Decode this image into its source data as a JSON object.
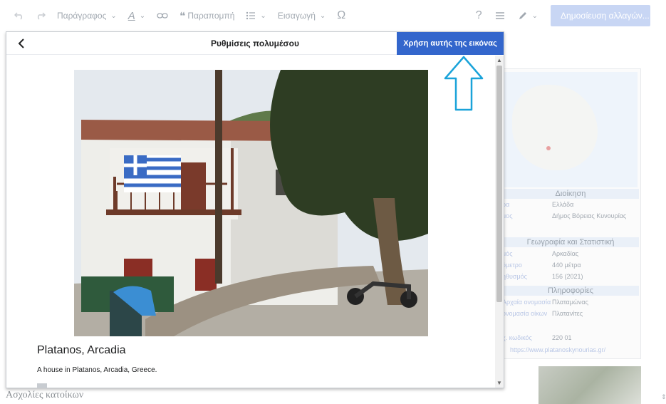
{
  "toolbar": {
    "undo_icon": "undo-icon",
    "redo_icon": "redo-icon",
    "paragraph_label": "Παράγραφος",
    "text_style_icon": "text-style-icon",
    "link_icon": "link-icon",
    "cite_label": "Παραπομπή",
    "list_icon": "bullet-list-icon",
    "insert_label": "Εισαγωγή",
    "special_char_label": "Ω",
    "help_label": "?",
    "publish_label": "Δημοσίευση αλλαγών..."
  },
  "dialog": {
    "title": "Ρυθμίσεις πολυμέσου",
    "back_icon": "chevron-left-icon",
    "use_button_label": "Χρήση αυτής της εικόνας",
    "image_title": "Platanos, Arcadia",
    "image_description": "A house in Platanos, Arcadia, Greece."
  },
  "infobox": {
    "section_admin": "Διοίκηση",
    "section_geo": "Γεωγραφία και Στατιστική",
    "section_info": "Πληροφορίες",
    "rows": [
      {
        "key": "ρα",
        "value": "Ελλάδα"
      },
      {
        "key": "μος",
        "value": "Δήμος Βόρειας Κυνουρίας"
      },
      {
        "key": "μός",
        "value": "Αρκαδίας"
      },
      {
        "key": "όμετρο",
        "value": "440 μέτρα"
      },
      {
        "key": "ηθυσμός",
        "value": "156 (2021)"
      },
      {
        "key": "Αρχαία ονομασία",
        "value": "Πλαταμώνας"
      },
      {
        "key": "ονομασία οίκων",
        "value": "Πλατανίτες"
      },
      {
        "key": "χ. κωδικός",
        "value": "220 01"
      }
    ],
    "website": "https://www.platanoskynourias.gr/"
  },
  "article": {
    "caption": "Ασχολίες κατοίκων"
  },
  "colors": {
    "accent": "#3366cc",
    "arrow": "#1aa3d9"
  }
}
